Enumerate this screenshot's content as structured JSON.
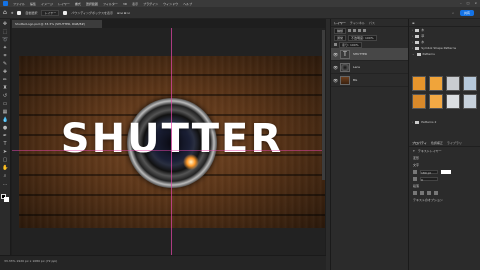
{
  "menubar": {
    "items": [
      "ファイル",
      "編集",
      "イメージ",
      "レイヤー",
      "書式",
      "選択範囲",
      "フィルター",
      "3D",
      "表示",
      "プラグイン",
      "ウィンドウ",
      "ヘルプ"
    ]
  },
  "options": {
    "layer_select": "レイヤー",
    "auto_select_label": "自動選択",
    "transform_label": "バウンディングボックスを表示",
    "share_label": "共有"
  },
  "document": {
    "tab_title": "ShutterLogo.psd @ 33.3% (SHUTTER, RGB/8#)",
    "title_text": "SHUTTER"
  },
  "status": {
    "text": "33.33%   1920 px x 1080 px (72 ppi)"
  },
  "layers_panel": {
    "tabs": [
      "レイヤー",
      "チャンネル",
      "パス"
    ],
    "filter_label": "種類",
    "blend_mode": "通常",
    "opacity": "不透明度: 100%",
    "fill": "塗り: 100%",
    "layers": [
      {
        "name": "SHUTTER",
        "thumb": "T"
      },
      {
        "name": "Lens",
        "thumb": ""
      },
      {
        "name": "BG",
        "thumb": ""
      }
    ]
  },
  "patterns_panel": {
    "folders": [
      {
        "name": "木"
      },
      {
        "name": "草"
      },
      {
        "name": "水"
      },
      {
        "name": "Symbol Shape Patterns"
      },
      {
        "name": "Patterns"
      },
      {
        "name": "Patterns 2"
      }
    ],
    "swatch_colors": [
      "#e7952c",
      "#f0a43a",
      "#c9ccd0",
      "#b6c9dc",
      "#d9892a",
      "#f2a945",
      "#dcdfe2",
      "#c7d1db"
    ]
  },
  "properties": {
    "tabs": [
      "プロパティ",
      "色調補正",
      "ライブラリ"
    ],
    "layer_type": "テキストレイヤー",
    "section_transform": "変形",
    "section_char": "文字",
    "section_para": "段落",
    "size": "180 pt",
    "tracking": "0",
    "section_more": "テキストのオプション"
  }
}
